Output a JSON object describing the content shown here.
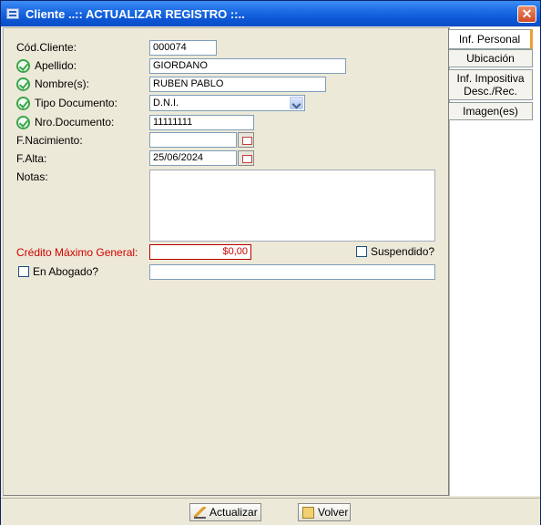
{
  "window": {
    "title": "Cliente ..:: ACTUALIZAR REGISTRO ::..",
    "close_glyph": "✕"
  },
  "tabs": [
    {
      "label": "Inf. Personal",
      "active": true
    },
    {
      "label": "Ubicación",
      "active": false
    },
    {
      "label_line1": "Inf. Impositiva",
      "label_line2": "Desc./Rec.",
      "active": false
    },
    {
      "label": "Imagen(es)",
      "active": false
    }
  ],
  "form": {
    "cod_cliente": {
      "label": "Cód.Cliente:",
      "value": "000074"
    },
    "apellido": {
      "label": "Apellido:",
      "value": "GIORDANO"
    },
    "nombres": {
      "label": "Nombre(s):",
      "value": "RUBEN PABLO"
    },
    "tipo_documento": {
      "label": "Tipo Documento:",
      "value": "D.N.I."
    },
    "nro_documento": {
      "label": "Nro.Documento:",
      "value": "11111111"
    },
    "f_nacimiento": {
      "label": "F.Nacimiento:",
      "value": ""
    },
    "f_alta": {
      "label": "F.Alta:",
      "value": "25/06/2024"
    },
    "notas": {
      "label": "Notas:",
      "value": ""
    },
    "credito": {
      "label": "Crédito Máximo General:",
      "value": "$0,00"
    },
    "suspendido": {
      "label": "Suspendido?",
      "checked": false
    },
    "en_abogado": {
      "label": "En Abogado?",
      "checked": false,
      "value": ""
    }
  },
  "footer": {
    "actualizar_label": "Actualizar",
    "volver_label": "Volver"
  },
  "colors": {
    "title_bar": "#0d57d6",
    "required_check": "#3aa54a",
    "credit_red": "#d00000",
    "active_tab_accent": "#f0a030"
  },
  "icons": [
    "window-icon",
    "close-icon",
    "check-icon",
    "calendar-icon",
    "chevron-down-icon",
    "pencil-icon",
    "back-icon"
  ]
}
